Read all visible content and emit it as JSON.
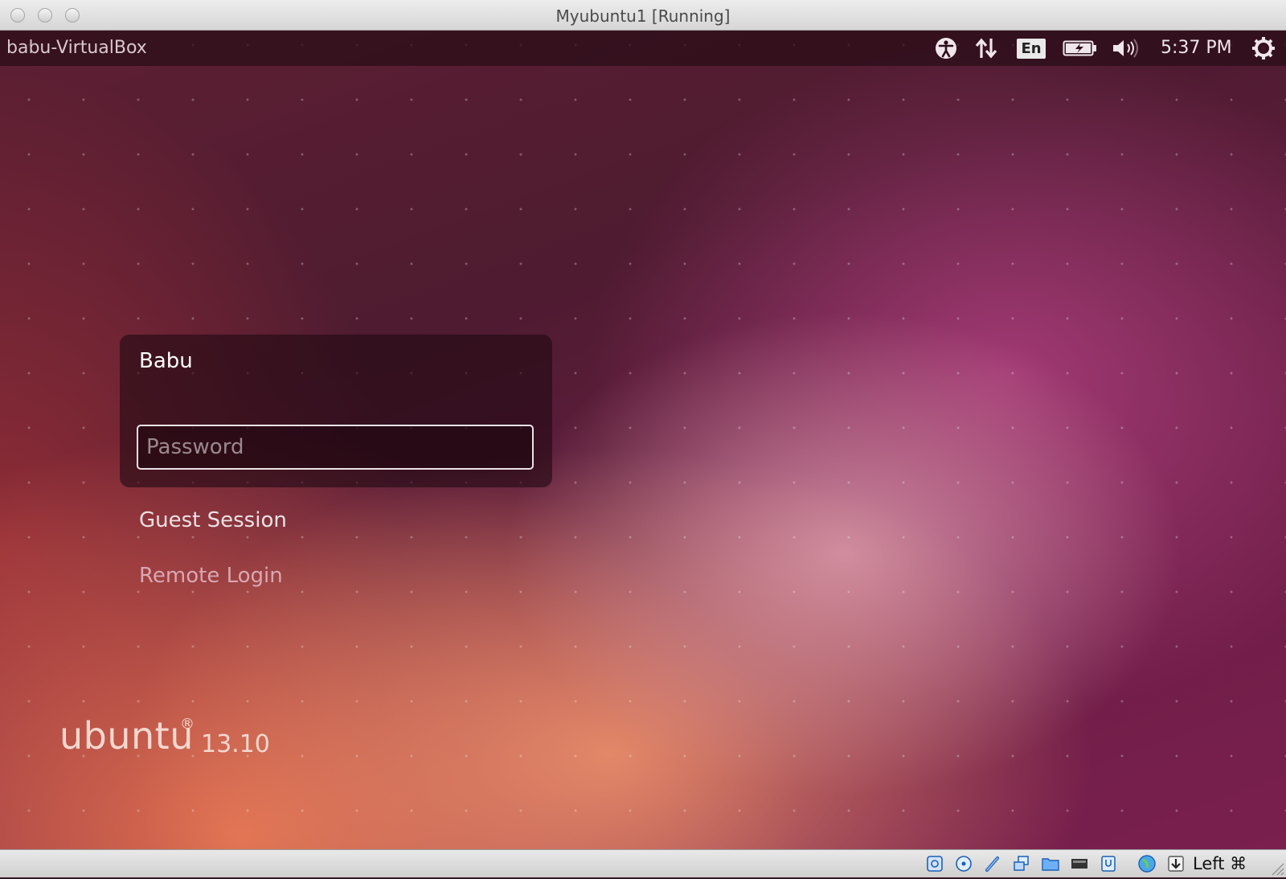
{
  "window": {
    "title": "Myubuntu1 [Running]"
  },
  "panel": {
    "hostname": "babu-VirtualBox",
    "language": "En",
    "clock": "5:37 PM",
    "icons": [
      "accessibility-icon",
      "network-icon",
      "keyboard-language-icon",
      "battery-icon",
      "volume-icon",
      "power-icon"
    ]
  },
  "greeter": {
    "username": "Babu",
    "password_placeholder": "Password",
    "password_value": "",
    "sessions": [
      "Guest Session",
      "Remote Login"
    ]
  },
  "branding": {
    "word": "ubuntu",
    "registered": "®",
    "version": "13.10"
  },
  "statusbar": {
    "icons": [
      "hard-disk-icon",
      "optical-drive-icon",
      "usb-icon",
      "network-adapter-icon",
      "shared-folders-icon",
      "display-icon",
      "video-capture-icon",
      "mouse-integration-icon",
      "host-key-arrow-icon"
    ],
    "host_key": "Left ⌘"
  },
  "colors": {
    "panel": "#280c16",
    "accent_text": "#d9a7b2",
    "wallpaper_base": "#5e1f33"
  }
}
